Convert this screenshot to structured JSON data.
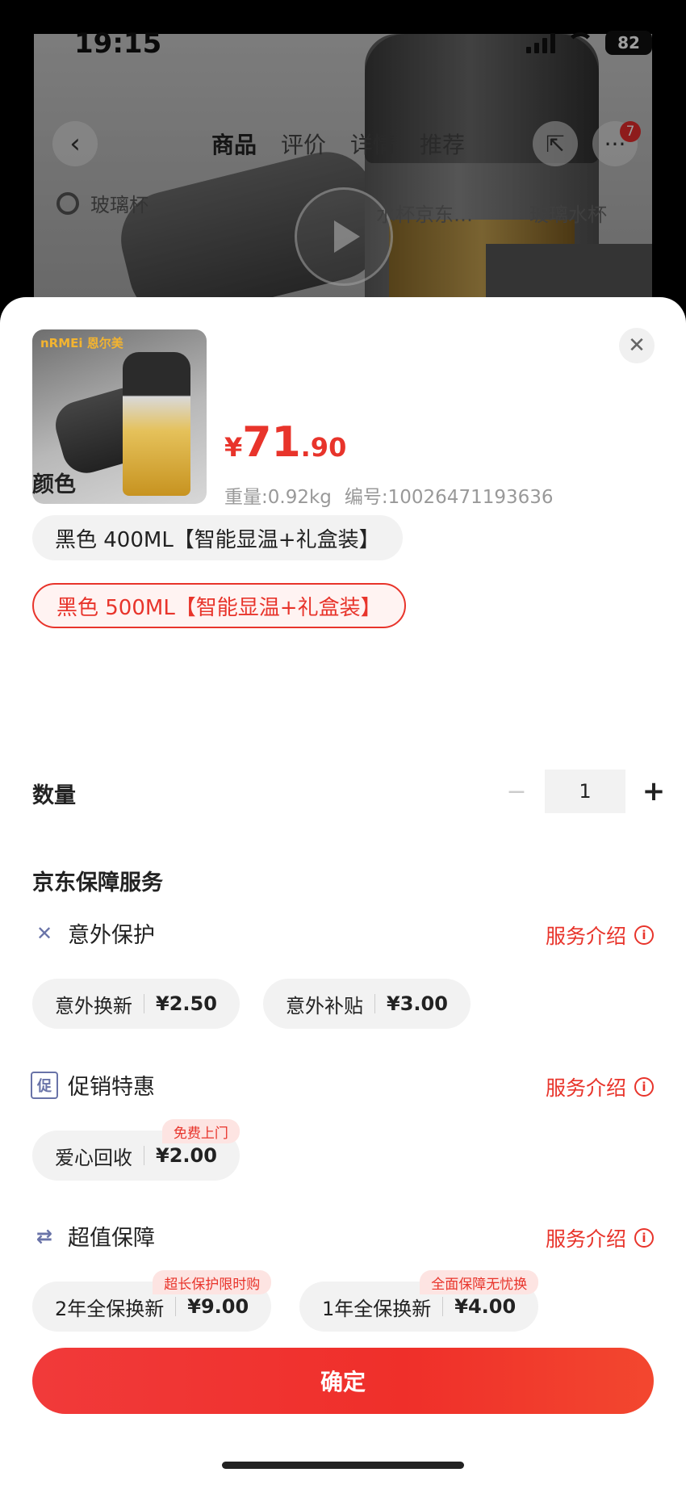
{
  "status_bar": {
    "time": "19:15",
    "battery": "82"
  },
  "background_page": {
    "tabs": [
      "商品",
      "评价",
      "详情",
      "推荐"
    ],
    "badge_count": "7",
    "search_text": "玻璃杯",
    "search_suggest_1": "水杯京东…",
    "search_suggest_2": "玻璃水杯",
    "brand": "nRMEi 恩尔美"
  },
  "product": {
    "price_symbol": "¥",
    "price_int": "71",
    "price_dec": ".90",
    "weight": "重量:0.92kg",
    "sku": "编号:10026471193636"
  },
  "color_section": {
    "title": "颜色",
    "options": [
      "黑色 400ML【智能显温+礼盒装】",
      "黑色 500ML【智能显温+礼盒装】"
    ],
    "selected_index": 1
  },
  "quantity": {
    "title": "数量",
    "value": "1",
    "minus": "−",
    "plus": "+"
  },
  "service": {
    "title": "京东保障服务",
    "link_label": "服务介绍",
    "groups": [
      {
        "name": "意外保护",
        "icon": "tools-icon",
        "items": [
          {
            "label": "意外换新",
            "price": "¥2.50",
            "tag": ""
          },
          {
            "label": "意外补贴",
            "price": "¥3.00",
            "tag": ""
          }
        ]
      },
      {
        "name": "促销特惠",
        "icon": "promo-icon",
        "items": [
          {
            "label": "爱心回收",
            "price": "¥2.00",
            "tag": "免费上门"
          }
        ]
      },
      {
        "name": "超值保障",
        "icon": "exchange-icon",
        "items": [
          {
            "label": "2年全保换新",
            "price": "¥9.00",
            "tag": "超长保护限时购"
          },
          {
            "label": "1年全保换新",
            "price": "¥4.00",
            "tag": "全面保障无忧换"
          }
        ]
      }
    ]
  },
  "confirm_label": "确定",
  "colors": {
    "accent": "#e8342b",
    "chip_bg": "#f2f2f2",
    "icon": "#6973a8"
  }
}
